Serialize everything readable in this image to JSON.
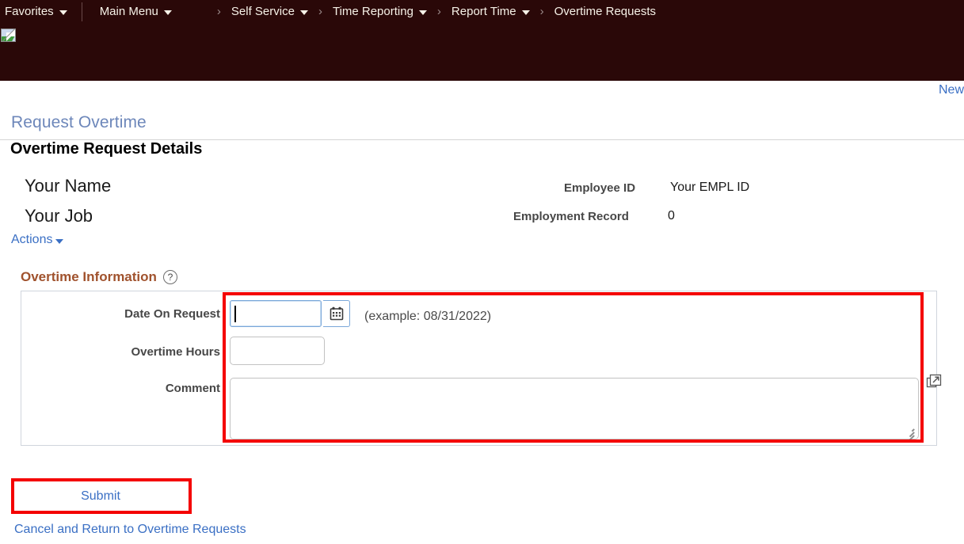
{
  "nav": {
    "favorites": "Favorites",
    "main_menu": "Main Menu",
    "breadcrumbs": [
      "Self Service",
      "Time Reporting",
      "Report Time",
      "Overtime Requests"
    ],
    "arrow_glyph": "›",
    "broken_image_icon": "broken-image-icon"
  },
  "toolbar": {
    "new_window_link": "New"
  },
  "page": {
    "title": "Request Overtime",
    "section_title": "Overtime Request Details"
  },
  "employee": {
    "name": "Your Name",
    "job": "Your Job",
    "employee_id_label": "Employee ID",
    "employee_id_value": "Your EMPL ID",
    "employment_record_label": "Employment Record",
    "employment_record_value": "0"
  },
  "actions": {
    "label": "Actions"
  },
  "overtime_information": {
    "header": "Overtime Information",
    "help_icon": "?",
    "fields": {
      "date_label": "Date On Request",
      "date_value": "",
      "date_placeholder": "",
      "date_example": "(example: 08/31/2022)",
      "calendar_icon": "calendar-icon",
      "hours_label": "Overtime Hours",
      "hours_value": "",
      "comment_label": "Comment",
      "comment_value": "",
      "expand_icon": "expand-popout-icon"
    }
  },
  "footer": {
    "submit_label": "Submit",
    "cancel_label": "Cancel and Return to Overtime Requests"
  },
  "colors": {
    "header_bar": "#2a0808",
    "link_blue": "#3a6fc4",
    "page_title_blue": "#6d87ba",
    "section_accent_brown": "#a0522d",
    "annotation_red": "#f40000",
    "label_gray": "#474747"
  }
}
